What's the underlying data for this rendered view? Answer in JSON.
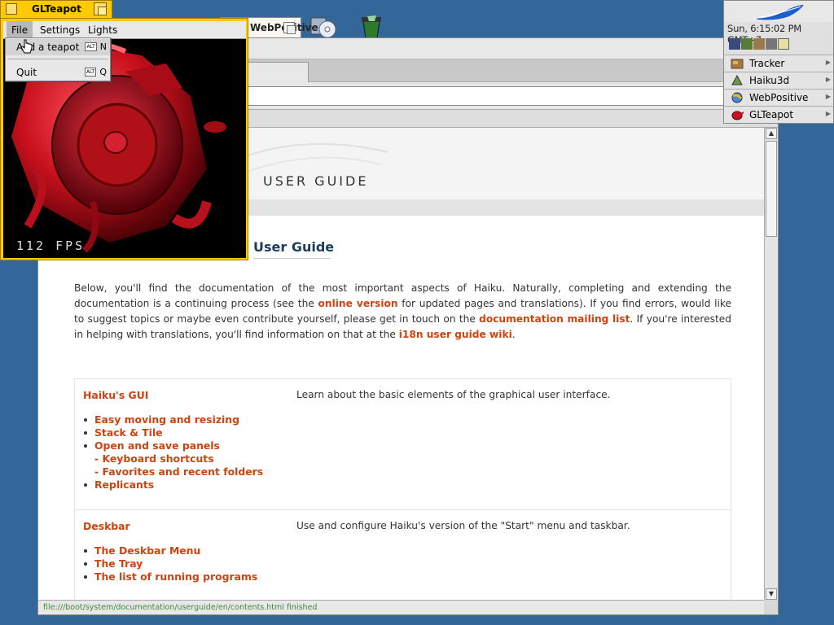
{
  "glteapot": {
    "title": "GLTeapot",
    "menu": [
      "File",
      "Settings",
      "Lights"
    ],
    "file_menu": [
      {
        "label": "Add a teapot",
        "shortcut_key": "N",
        "modifier": "ALT"
      },
      {
        "label": "Quit",
        "shortcut_key": "Q",
        "modifier": "ALT"
      }
    ],
    "fps": "112 FPS",
    "colors": {
      "tab": "#ffcb00",
      "teapot": "#c8101c"
    }
  },
  "webpositive": {
    "tab_title": "WebPositive",
    "page": {
      "banner_title": "USER GUIDE",
      "heading": "User Guide",
      "intro_parts": [
        "Below, you'll find the documentation of the most important aspects of Haiku. Naturally, completing and extending the documentation is a continuing process (see the ",
        "online version",
        " for updated pages and translations). If you find errors, would like to suggest topics or maybe even contribute yourself, please get in touch on the ",
        "documentation mailing list",
        ". If you're interested in helping with translations, you'll find information on that at the ",
        "i18n user guide wiki",
        "."
      ],
      "toc": [
        {
          "title": "Haiku's GUI",
          "description": "Learn about the basic elements of the graphical user interface.",
          "items": [
            "Easy moving and resizing",
            "Stack & Tile",
            "Open and save panels",
            "- Keyboard shortcuts",
            "- Favorites and recent folders",
            "Replicants"
          ]
        },
        {
          "title": "Deskbar",
          "description": "Use and configure Haiku's version of the \"Start\" menu and taskbar.",
          "items": [
            "The Deskbar Menu",
            "The Tray",
            "The list of running programs"
          ]
        }
      ]
    },
    "status": "file:///boot/system/documentation/userguide/en/contents.html finished",
    "colors": {
      "link": "#cc4411",
      "heading": "#1d3d5c",
      "status": "#3a8a3a"
    }
  },
  "deskbar": {
    "clock": "Sun, 6:15:02 PM GMT+7",
    "apps": [
      {
        "name": "Tracker",
        "icon": "tracker-icon"
      },
      {
        "name": "Haiku3d",
        "icon": "haiku3d-icon"
      },
      {
        "name": "WebPositive",
        "icon": "webpositive-icon"
      },
      {
        "name": "GLTeapot",
        "icon": "glteapot-icon"
      }
    ]
  },
  "desktop": {
    "background": "#336699"
  }
}
